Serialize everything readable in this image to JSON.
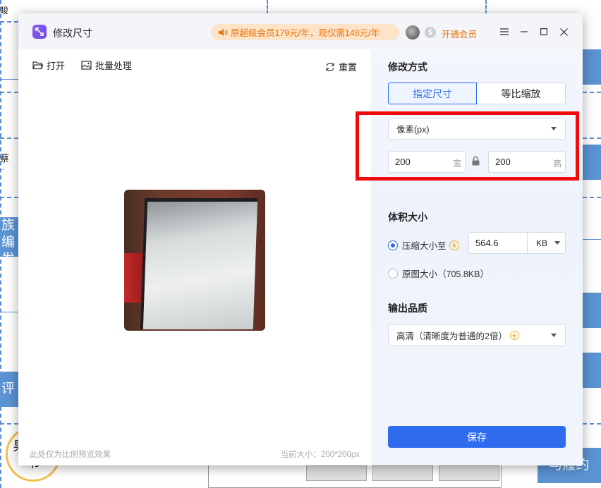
{
  "background": {
    "fragments": [
      "睃",
      "蔡",
      "..",
      "族 编",
      "发布",
      "评",
      "果通知",
      "书",
      "与履约"
    ]
  },
  "titlebar": {
    "title": "修改尺寸",
    "promo_text": "原超级会员179元/年，现仅需148元/年",
    "vip_label": "开通会员"
  },
  "toolbar": {
    "open_label": "打开",
    "batch_label": "批量处理",
    "reset_label": "重置"
  },
  "preview": {
    "note": "此处仅为比例预览效果",
    "current_size": "当前大小：200*200px"
  },
  "panel": {
    "mode_title": "修改方式",
    "tabs": [
      {
        "label": "指定尺寸",
        "active": true
      },
      {
        "label": "等比缩放",
        "active": false
      }
    ],
    "unit_select": "像素(px)",
    "width_value": "200",
    "width_unit": "宽",
    "height_value": "200",
    "height_unit": "高",
    "volume_title": "体积大小",
    "compress_label": "压缩大小至",
    "compress_value": "564.6",
    "compress_unit": "KB",
    "original_label": "原图大小（705.8KB）",
    "quality_title": "输出品质",
    "quality_select": "高清（清晰度为普通的2倍）",
    "save_label": "保存"
  },
  "colors": {
    "accent": "#2f6bef",
    "promo": "#e8740d",
    "highlight": "#f00a0a"
  }
}
